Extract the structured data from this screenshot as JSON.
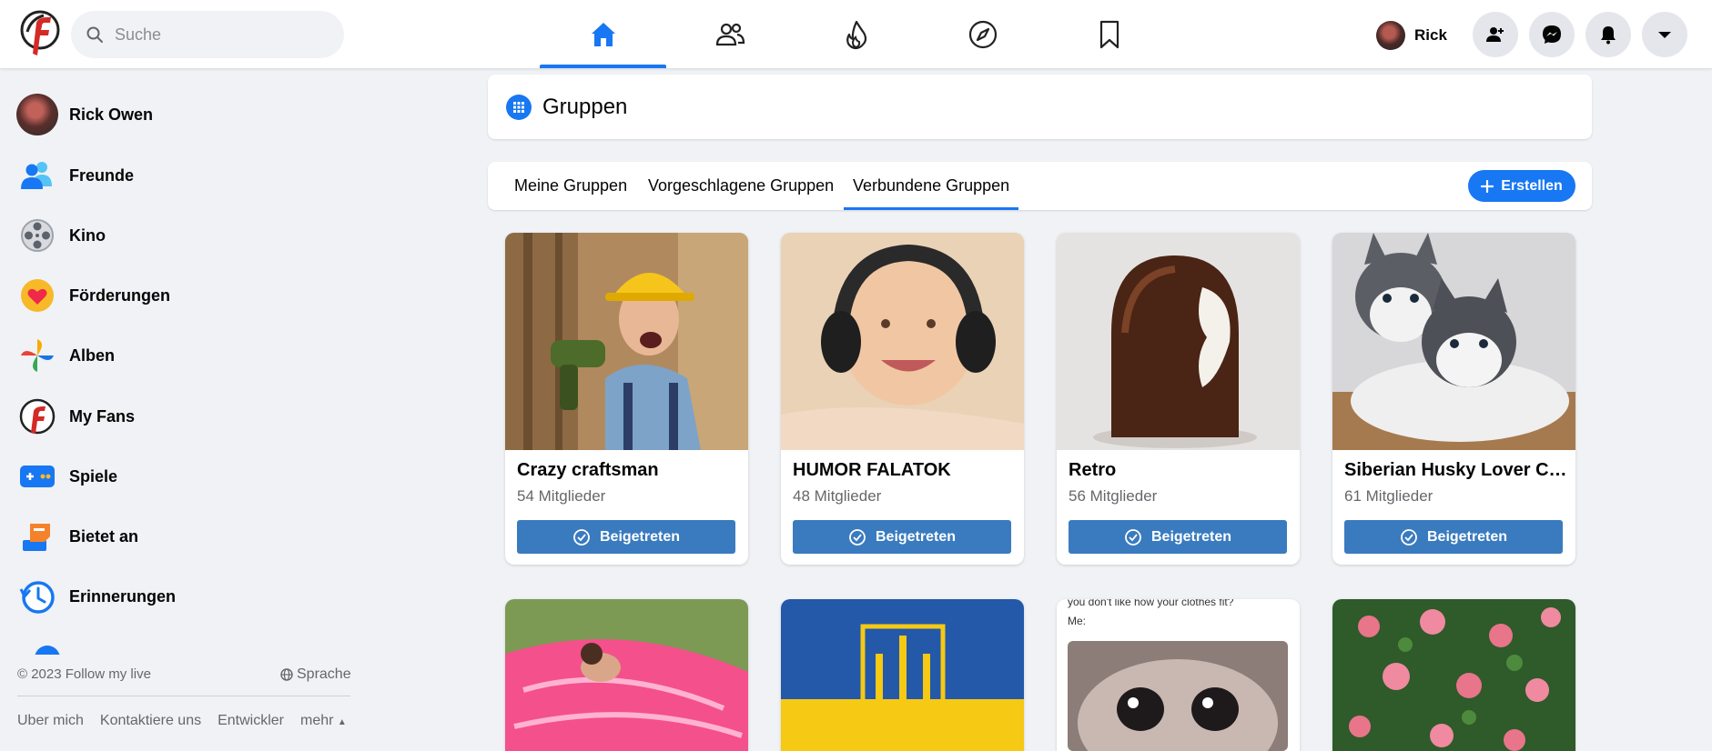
{
  "search": {
    "placeholder": "Suche"
  },
  "profile": {
    "name": "Rick"
  },
  "sidebar": {
    "items": [
      {
        "label": "Rick Owen"
      },
      {
        "label": "Freunde"
      },
      {
        "label": "Kino"
      },
      {
        "label": "Förderungen"
      },
      {
        "label": "Alben"
      },
      {
        "label": "My Fans"
      },
      {
        "label": "Spiele"
      },
      {
        "label": "Bietet an"
      },
      {
        "label": "Erinnerungen"
      }
    ]
  },
  "footer": {
    "copyright": "© 2023 Follow my live",
    "language": "Sprache",
    "links": [
      "Uber mich",
      "Kontaktiere uns",
      "Entwickler",
      "mehr"
    ]
  },
  "page": {
    "title": "Gruppen"
  },
  "tabs": [
    {
      "label": "Meine Gruppen"
    },
    {
      "label": "Vorgeschlagene Gruppen"
    },
    {
      "label": "Verbundene Gruppen"
    }
  ],
  "create_label": "Erstellen",
  "groups": [
    {
      "name": "Crazy craftsman",
      "members": "54 Mitglieder",
      "button": "Beigetreten"
    },
    {
      "name": "HUMOR FALATOK",
      "members": "48 Mitglieder",
      "button": "Beigetreten"
    },
    {
      "name": "Retro",
      "members": "56 Mitglieder",
      "button": "Beigetreten"
    },
    {
      "name": "Siberian Husky Lover Club",
      "members": "61 Mitglieder",
      "button": "Beigetreten"
    }
  ],
  "groups_row2_texts": {
    "meme_caption": "you don't like how your clothes fit?",
    "meme_caption2": "Me:"
  },
  "colors": {
    "accent": "#1877f2",
    "joined": "#3a7bbf",
    "background": "#f0f2f5"
  }
}
